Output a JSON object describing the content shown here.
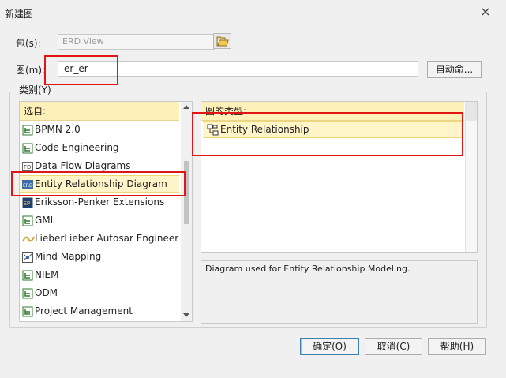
{
  "window": {
    "title": "新建图",
    "close_glyph": "×"
  },
  "form": {
    "package_label": "包(s):",
    "package_value": "ERD View",
    "name_label": "图(m):",
    "name_value": "er_er",
    "auto_name_button": "自动命...",
    "category_label": "类别(Y)"
  },
  "left_list": {
    "header": "选自:",
    "items": [
      {
        "label": "BPMN 2.0",
        "icon": "profile-tree-icon"
      },
      {
        "label": "Code Engineering",
        "icon": "profile-tree-icon"
      },
      {
        "label": "Data Flow Diagrams",
        "icon": "dfd-icon"
      },
      {
        "label": "Entity Relationship Diagram",
        "icon": "erd-icon",
        "selected": true
      },
      {
        "label": "Eriksson-Penker Extensions",
        "icon": "ep-icon"
      },
      {
        "label": "GML",
        "icon": "profile-tree-icon"
      },
      {
        "label": "LieberLieber Autosar Engineer",
        "icon": "lieberlieber-icon"
      },
      {
        "label": "Mind Mapping",
        "icon": "mindmap-icon"
      },
      {
        "label": "NIEM",
        "icon": "profile-tree-icon"
      },
      {
        "label": "ODM",
        "icon": "profile-tree-icon"
      },
      {
        "label": "Project Management",
        "icon": "profile-tree-icon"
      }
    ]
  },
  "right_list": {
    "header": "图的类型:",
    "items": [
      {
        "label": "Entity Relationship",
        "icon": "entity-relationship-icon",
        "selected": true
      }
    ]
  },
  "description": "Diagram used for Entity Relationship Modeling.",
  "buttons": {
    "ok": "确定(O)",
    "cancel": "取消(C)",
    "help": "帮助(H)"
  },
  "colors": {
    "highlight": "#e01515",
    "header_bg": "#fdf0b8",
    "selected_bg": "#fff5c8"
  }
}
